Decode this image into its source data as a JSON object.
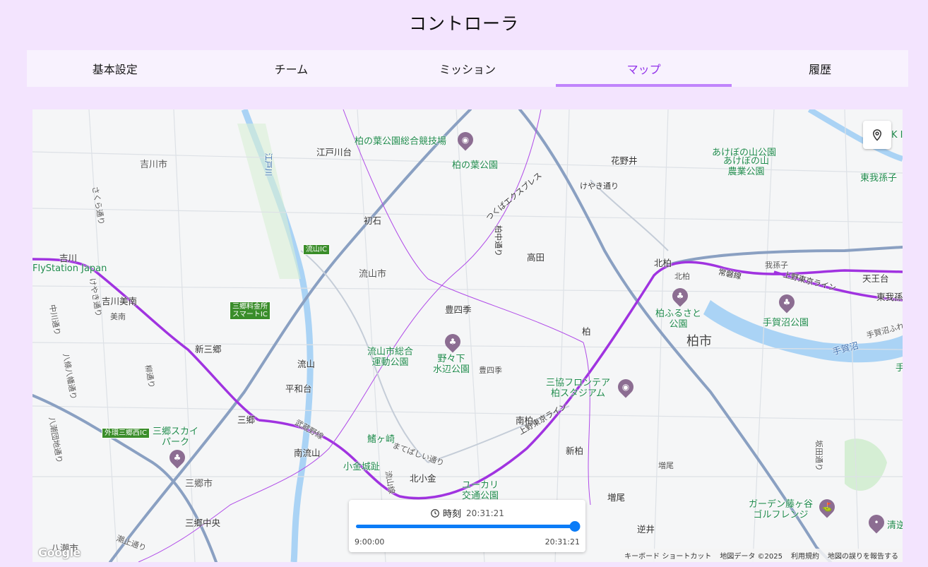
{
  "page_title": "コントローラ",
  "tabs": [
    {
      "label": "基本設定",
      "active": false
    },
    {
      "label": "チーム",
      "active": false
    },
    {
      "label": "ミッション",
      "active": false
    },
    {
      "label": "マップ",
      "active": true
    },
    {
      "label": "履歴",
      "active": false
    }
  ],
  "accent_color": "#9333ea",
  "map": {
    "labels": {
      "yoshikawa_city": "吉川市",
      "nagareyama_city": "流山市",
      "kashiwa_city": "柏市",
      "misato_city": "三郷市",
      "yashio_city": "八潮市",
      "edogawadai": "江戸川台",
      "hatsuishi": "初石",
      "kashiwanoha_stadium": "柏の葉公園総合競技場",
      "kashiwanoha_park": "柏の葉公園",
      "hanano_i": "花野井",
      "akebono_park": "あけぼの山公園",
      "akebono_farm": "あけぼの山\n農業公園",
      "higashi_abiko": "東我孫子",
      "keyaki_dori": "けやき通り",
      "tsukuba_express": "つくばエクスプレス",
      "kashiwanaka_dori": "柏中通り",
      "takada": "高田",
      "kita_kashiwa": "北柏",
      "kita_kashiwa_area": "北柏",
      "abiko": "我孫子",
      "ueno_tokyo_line": "上野東京ライン",
      "joban_line": "常磐線",
      "tennodai": "天王台",
      "higashi_abiko_st": "東我孫",
      "kashiwa_furusato": "柏ふるさと\n公園",
      "tegano_park": "手賀沼公園",
      "teganuma": "手賀沼",
      "teganuma_fureai": "手賀沼ふれ",
      "yoshikawa_st": "吉川",
      "flystation": "FlyStation Japan",
      "sakura_dori": "さくら通り",
      "keyaki_dori2": "けやき通り",
      "yoshikawa_minami": "吉川美南",
      "minami": "美南",
      "nakagawa_dori": "中川通り",
      "shin_misato": "新三郷",
      "yashio_yoshikawa": "八條八幡通り",
      "yanagi_dori": "柳通り",
      "toyoshiki": "豊四季",
      "toyoshiki_area": "豊四季",
      "kashiwa_st": "柏",
      "nagareyama_sports": "流山市総合\n運動公園",
      "nonoshita_park": "野々下\n水辺公園",
      "nagareyama_st": "流山",
      "heiwadai": "平和台",
      "mitsukyo_stadium": "三協フロンテア\n柏スタジアム",
      "edogawa_river": "江戸川",
      "misato_st": "三郷",
      "musashino_line": "武蔵野線",
      "minami_nagareyama": "南流山",
      "unagaya": "鰭ヶ崎",
      "kogane_castle": "小金城趾",
      "mabashi_dori": "まてばしい通り",
      "kita_kogane": "北小金",
      "yukari_park": "ユーカリ\n交通公園",
      "minami_kashiwa": "南柏",
      "shin_kashiwa": "新柏",
      "masuo": "増尾",
      "masuo_st": "増尾",
      "sakai": "逆井",
      "misato_sky_park": "三郷スカイ\nパーク",
      "misato_chuo": "三郷中央",
      "yashio_route": "八潮団地通り",
      "shiodome_dori": "潮止通り",
      "garden_golf": "ガーデン藤ヶ谷\nゴルフレンジ",
      "kiyomi": "清逆",
      "kd": "K I",
      "te": "手",
      "sakado_dori": "坂田通り",
      "nagareyama_ic": "流山IC",
      "misato_toll": "三郷料金所\nスマートIC",
      "gaikan_misato": "外環三郷西IC",
      "nagareyama_line": "流山線"
    },
    "attribution": {
      "shortcuts": "キーボード ショートカット",
      "map_data": "地図データ ©2025",
      "terms": "利用規約",
      "report": "地図の誤りを報告する"
    },
    "google_logo": "Google",
    "location_icon": "map-pin-icon"
  },
  "time_control": {
    "label": "時刻",
    "current": "20:31:21",
    "min_label": "9:00:00",
    "max_label": "20:31:21",
    "value_fraction": 1.0,
    "slider_color": "#0b7cf7"
  }
}
